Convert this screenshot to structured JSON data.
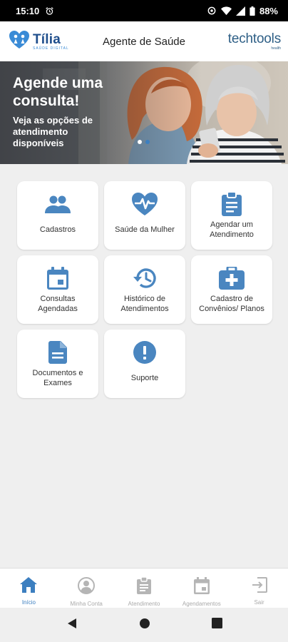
{
  "status_bar": {
    "time": "15:10",
    "battery": "88%"
  },
  "header": {
    "logo_left": {
      "name": "Tília",
      "sub": "SAÚDE DIGITAL"
    },
    "title": "Agente de Saúde",
    "logo_right": {
      "name": "techtools",
      "sub": "health"
    }
  },
  "banner": {
    "headline": "Agende uma consulta!",
    "subline": "Veja as opções de atendimento disponíveis"
  },
  "tiles": [
    {
      "label": "Cadastros",
      "icon": "people-icon"
    },
    {
      "label": "Saúde da Mulher",
      "icon": "heart-pulse-icon"
    },
    {
      "label": "Agendar um Atendimento",
      "icon": "clipboard-icon"
    },
    {
      "label": "Consultas Agendadas",
      "icon": "calendar-icon"
    },
    {
      "label": "Histórico de Atendimentos",
      "icon": "history-icon"
    },
    {
      "label": "Cadastro de Convênios/ Planos",
      "icon": "medical-case-icon"
    },
    {
      "label": "Documentos e Exames",
      "icon": "document-icon"
    },
    {
      "label": "Suporte",
      "icon": "alert-circle-icon"
    }
  ],
  "bottom_nav": [
    {
      "label": "Início",
      "icon": "home-icon",
      "active": true
    },
    {
      "label": "Minha Conta",
      "icon": "account-icon",
      "active": false
    },
    {
      "label": "Atendimento",
      "icon": "clipboard-icon",
      "active": false
    },
    {
      "label": "Agendamentos",
      "icon": "calendar-icon",
      "active": false
    },
    {
      "label": "Sair",
      "icon": "exit-icon",
      "active": false
    }
  ],
  "colors": {
    "accent": "#3c7fc0",
    "nav_inactive": "#b5b5b5",
    "brand_dark": "#1f4e8c"
  }
}
